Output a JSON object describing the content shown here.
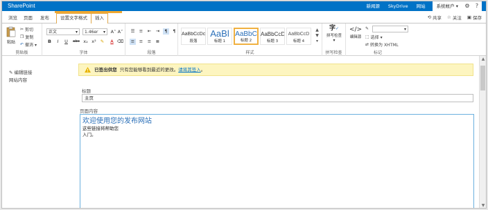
{
  "suite": {
    "brand": "SharePoint",
    "links": [
      "新闻源",
      "SkyDrive",
      "网站"
    ],
    "account": "系统帐户 ▾",
    "gear_icon": "gear-icon",
    "help_icon": "help-icon"
  },
  "tabs": {
    "items": [
      "浏览",
      "页面",
      "发布",
      "设置文字格式",
      "插入"
    ],
    "selected": "设置文字格式"
  },
  "page_actions": {
    "share": "共享",
    "follow": "关注",
    "save": "保存"
  },
  "ribbon": {
    "clipboard": {
      "paste": "粘贴",
      "cut": "剪切",
      "copy": "复制",
      "undo": "撤消 ▾",
      "label": "剪贴板"
    },
    "font": {
      "family": "正文",
      "size": "1.46er",
      "bold": "B",
      "italic": "I",
      "underline": "U",
      "strike": "abc",
      "sub": "x₂",
      "sup": "x²",
      "label": "字体"
    },
    "paragraph": {
      "label": "段落"
    },
    "styles": {
      "items": [
        {
          "preview": "AaBbCcDc",
          "name": "段落"
        },
        {
          "preview": "AaBl",
          "name": "标题 1"
        },
        {
          "preview": "AaBbC",
          "name": "标题 2"
        },
        {
          "preview": "AaBbCcD",
          "name": "标题 3"
        },
        {
          "preview": "AaBbCcD",
          "name": "标题 4"
        }
      ],
      "selected": "标题 2",
      "label": "样式"
    },
    "spelling": {
      "button": "拼写检查",
      "label": "拼写检查"
    },
    "markup": {
      "edit_source": "编辑源",
      "select": "选择 ▾",
      "convert": "转换为 XHTML",
      "label": "标记"
    }
  },
  "nav": {
    "edit_links": "编辑链接",
    "site_contents": "网站内容"
  },
  "warning": {
    "status": "已签出供您",
    "message": "只有您能够看到最近的更改。",
    "link": "请将其签入"
  },
  "form": {
    "title_label": "标题",
    "title_value": "主页",
    "content_label": "页面内容",
    "content_heading": "欢迎使用您的发布网站",
    "content_line1": "这些链接将帮助您",
    "content_line2": "入门。"
  },
  "colors": {
    "suite_bg": "#0072c6",
    "context_tab": "#f0a830",
    "warning_bg": "#fdf5c0",
    "heading_blue": "#2a6fb8"
  }
}
